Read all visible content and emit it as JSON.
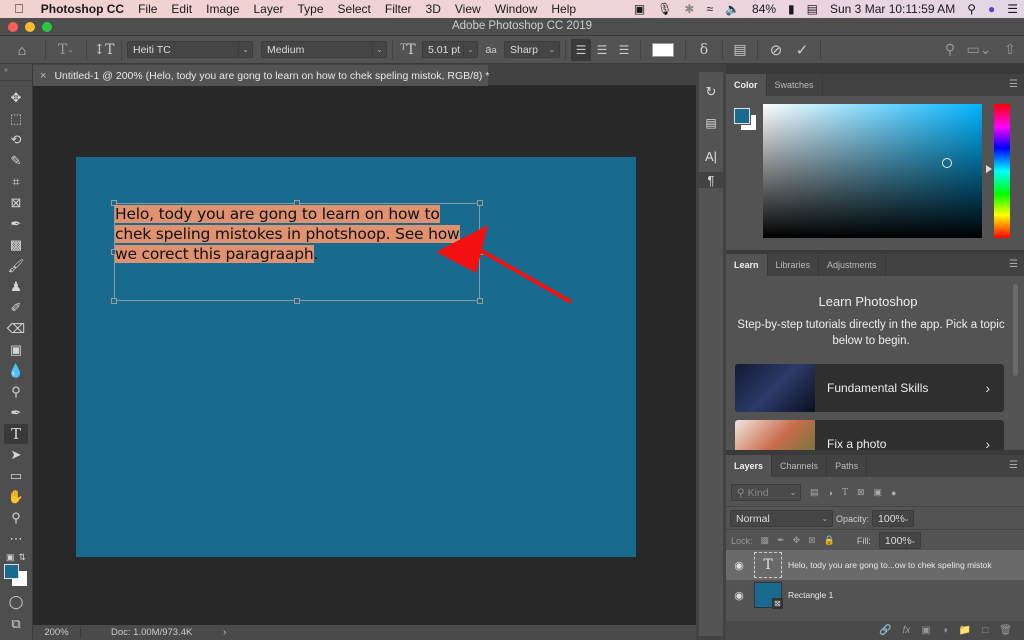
{
  "menubar": {
    "app_name": "Photoshop CC",
    "items": [
      "File",
      "Edit",
      "Image",
      "Layer",
      "Type",
      "Select",
      "Filter",
      "3D",
      "View",
      "Window",
      "Help"
    ],
    "battery": "84%",
    "datetime": "Sun 3 Mar  10:11:59 AM"
  },
  "window": {
    "title": "Adobe Photoshop CC 2019"
  },
  "options": {
    "font_family": "Heiti TC",
    "font_style": "Medium",
    "font_size": "5.01 pt",
    "antialias": "Sharp",
    "text_color": "#ffffff"
  },
  "document": {
    "tab_title": "Untitled-1 @ 200% (Helo, tody you are gong to learn on how to  chek speling mistok, RGB/8) *",
    "zoom": "200%",
    "doc_size": "Doc: 1.00M/973.4K",
    "artboard_color": "#196a8f",
    "paragraph_lines": [
      "Helo, tody you are gong to learn on how to ",
      "chek speling mistokes in photshoop. See how ",
      "we corect this paragraaph"
    ],
    "paragraph_end": "."
  },
  "color_panel": {
    "tabs": [
      "Color",
      "Swatches"
    ],
    "foreground": "#196a8f",
    "background": "#ffffff"
  },
  "learn_panel": {
    "tabs": [
      "Learn",
      "Libraries",
      "Adjustments"
    ],
    "title": "Learn Photoshop",
    "description": "Step-by-step tutorials directly in the app. Pick a topic below to begin.",
    "cards": [
      {
        "label": "Fundamental Skills"
      },
      {
        "label": "Fix a photo"
      }
    ]
  },
  "layers_panel": {
    "tabs": [
      "Layers",
      "Channels",
      "Paths"
    ],
    "filter_placeholder": "Kind",
    "blend_mode": "Normal",
    "opacity_label": "Opacity:",
    "opacity": "100%",
    "lock_label": "Lock:",
    "fill_label": "Fill:",
    "fill": "100%",
    "layers": [
      {
        "name": "Helo, tody you are gong to...ow to  chek speling mistok",
        "type": "text",
        "visible": true,
        "selected": true
      },
      {
        "name": "Rectangle 1",
        "type": "shape",
        "visible": true,
        "selected": false
      }
    ]
  }
}
